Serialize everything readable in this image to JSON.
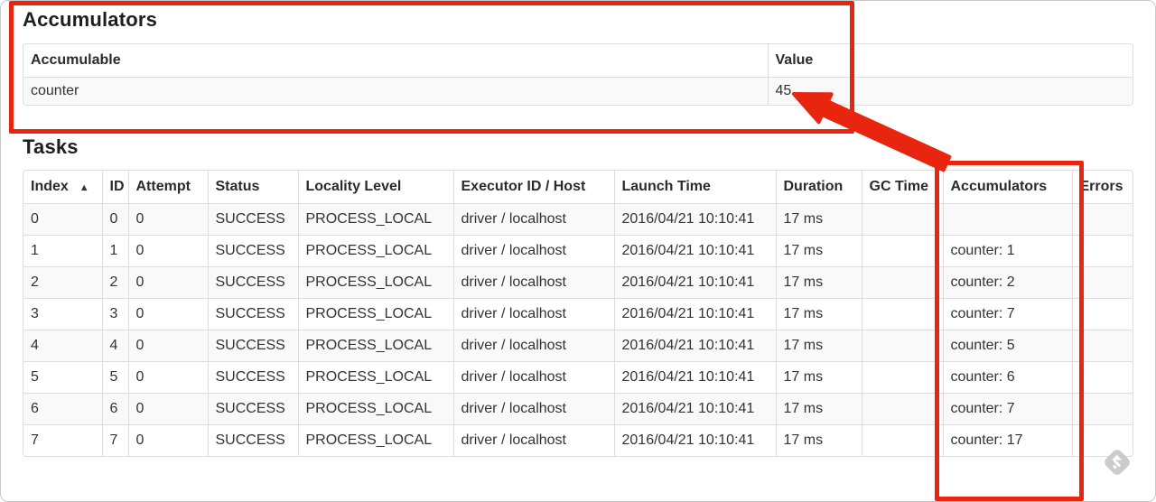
{
  "accumulators_section": {
    "title": "Accumulators",
    "table": {
      "columns": [
        "Accumulable",
        "Value"
      ],
      "rows": [
        {
          "accumulable": "counter",
          "value": "45"
        }
      ]
    }
  },
  "tasks_section": {
    "title": "Tasks",
    "table": {
      "columns": [
        "Index",
        "ID",
        "Attempt",
        "Status",
        "Locality Level",
        "Executor ID / Host",
        "Launch Time",
        "Duration",
        "GC Time",
        "Accumulators",
        "Errors"
      ],
      "sort_indicator": "▲",
      "rows": [
        {
          "index": "0",
          "id": "0",
          "attempt": "0",
          "status": "SUCCESS",
          "locality_level": "PROCESS_LOCAL",
          "executor_id_host": "driver / localhost",
          "launch_time": "2016/04/21 10:10:41",
          "duration": "17 ms",
          "gc_time": "",
          "accumulators": "",
          "errors": ""
        },
        {
          "index": "1",
          "id": "1",
          "attempt": "0",
          "status": "SUCCESS",
          "locality_level": "PROCESS_LOCAL",
          "executor_id_host": "driver / localhost",
          "launch_time": "2016/04/21 10:10:41",
          "duration": "17 ms",
          "gc_time": "",
          "accumulators": "counter: 1",
          "errors": ""
        },
        {
          "index": "2",
          "id": "2",
          "attempt": "0",
          "status": "SUCCESS",
          "locality_level": "PROCESS_LOCAL",
          "executor_id_host": "driver / localhost",
          "launch_time": "2016/04/21 10:10:41",
          "duration": "17 ms",
          "gc_time": "",
          "accumulators": "counter: 2",
          "errors": ""
        },
        {
          "index": "3",
          "id": "3",
          "attempt": "0",
          "status": "SUCCESS",
          "locality_level": "PROCESS_LOCAL",
          "executor_id_host": "driver / localhost",
          "launch_time": "2016/04/21 10:10:41",
          "duration": "17 ms",
          "gc_time": "",
          "accumulators": "counter: 7",
          "errors": ""
        },
        {
          "index": "4",
          "id": "4",
          "attempt": "0",
          "status": "SUCCESS",
          "locality_level": "PROCESS_LOCAL",
          "executor_id_host": "driver / localhost",
          "launch_time": "2016/04/21 10:10:41",
          "duration": "17 ms",
          "gc_time": "",
          "accumulators": "counter: 5",
          "errors": ""
        },
        {
          "index": "5",
          "id": "5",
          "attempt": "0",
          "status": "SUCCESS",
          "locality_level": "PROCESS_LOCAL",
          "executor_id_host": "driver / localhost",
          "launch_time": "2016/04/21 10:10:41",
          "duration": "17 ms",
          "gc_time": "",
          "accumulators": "counter: 6",
          "errors": ""
        },
        {
          "index": "6",
          "id": "6",
          "attempt": "0",
          "status": "SUCCESS",
          "locality_level": "PROCESS_LOCAL",
          "executor_id_host": "driver / localhost",
          "launch_time": "2016/04/21 10:10:41",
          "duration": "17 ms",
          "gc_time": "",
          "accumulators": "counter: 7",
          "errors": ""
        },
        {
          "index": "7",
          "id": "7",
          "attempt": "0",
          "status": "SUCCESS",
          "locality_level": "PROCESS_LOCAL",
          "executor_id_host": "driver / localhost",
          "launch_time": "2016/04/21 10:10:41",
          "duration": "17 ms",
          "gc_time": "",
          "accumulators": "counter: 17",
          "errors": ""
        }
      ]
    }
  },
  "annotation": {
    "highlight_color": "#e8250f"
  },
  "colors": {
    "row_stripe": "#f9f9f9",
    "table_border": "#dddddd",
    "text": "#333333"
  },
  "watermark": {
    "icon": "skitch-logo"
  }
}
